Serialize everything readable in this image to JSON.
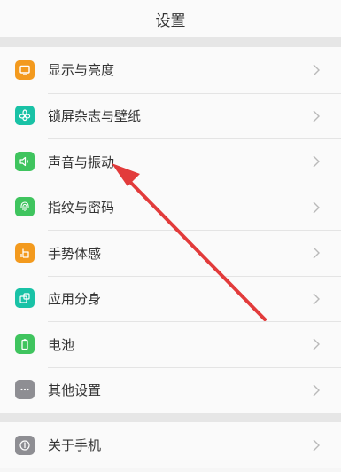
{
  "header": {
    "title": "设置"
  },
  "groups": [
    {
      "items": [
        {
          "label": "显示与亮度",
          "icon": "display-icon",
          "color": "#f39a1e"
        },
        {
          "label": "锁屏杂志与壁纸",
          "icon": "flower-icon",
          "color": "#19c2a6"
        },
        {
          "label": "声音与振动",
          "icon": "speaker-icon",
          "color": "#3fc45e"
        },
        {
          "label": "指纹与密码",
          "icon": "fingerprint-icon",
          "color": "#3fc45e"
        },
        {
          "label": "手势体感",
          "icon": "hand-icon",
          "color": "#f39a1e"
        },
        {
          "label": "应用分身",
          "icon": "app-clone-icon",
          "color": "#19c2a6"
        },
        {
          "label": "电池",
          "icon": "battery-icon",
          "color": "#3fc45e"
        },
        {
          "label": "其他设置",
          "icon": "more-icon",
          "color": "#8e8e93"
        }
      ]
    },
    {
      "items": [
        {
          "label": "关于手机",
          "icon": "info-icon",
          "color": "#8e8e93"
        }
      ]
    }
  ],
  "annotation": {
    "color": "#e23b3b"
  }
}
